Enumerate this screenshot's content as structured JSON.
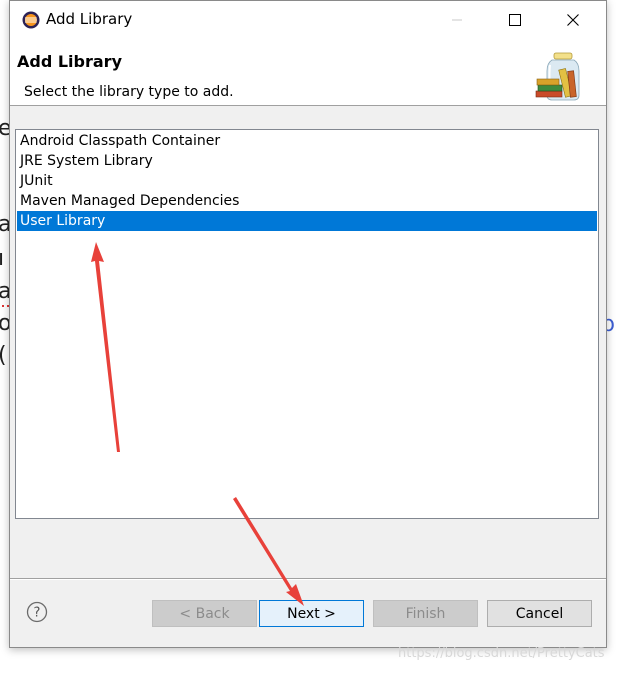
{
  "window": {
    "title": "Add Library"
  },
  "header": {
    "title": "Add Library",
    "description": "Select the library type to add."
  },
  "library_types": [
    {
      "label": "Android Classpath Container",
      "selected": false
    },
    {
      "label": "JRE System Library",
      "selected": false
    },
    {
      "label": "JUnit",
      "selected": false
    },
    {
      "label": "Maven Managed Dependencies",
      "selected": false
    },
    {
      "label": "User Library",
      "selected": true
    }
  ],
  "buttons": {
    "back": "< Back",
    "next": "Next >",
    "finish": "Finish",
    "cancel": "Cancel"
  },
  "help": {
    "glyph": "?"
  },
  "background_fragments": [
    "e",
    "a",
    "a",
    "(",
    "p"
  ],
  "watermark": "https://blog.csdn.net/PrettyCats",
  "colors": {
    "selection": "#0078d7",
    "annotation_arrow": "#e8413a",
    "link_fragment": "#3d5fd3"
  },
  "icons": {
    "app": "eclipse-icon",
    "header": "library-jar-books-icon",
    "help": "help-icon"
  }
}
